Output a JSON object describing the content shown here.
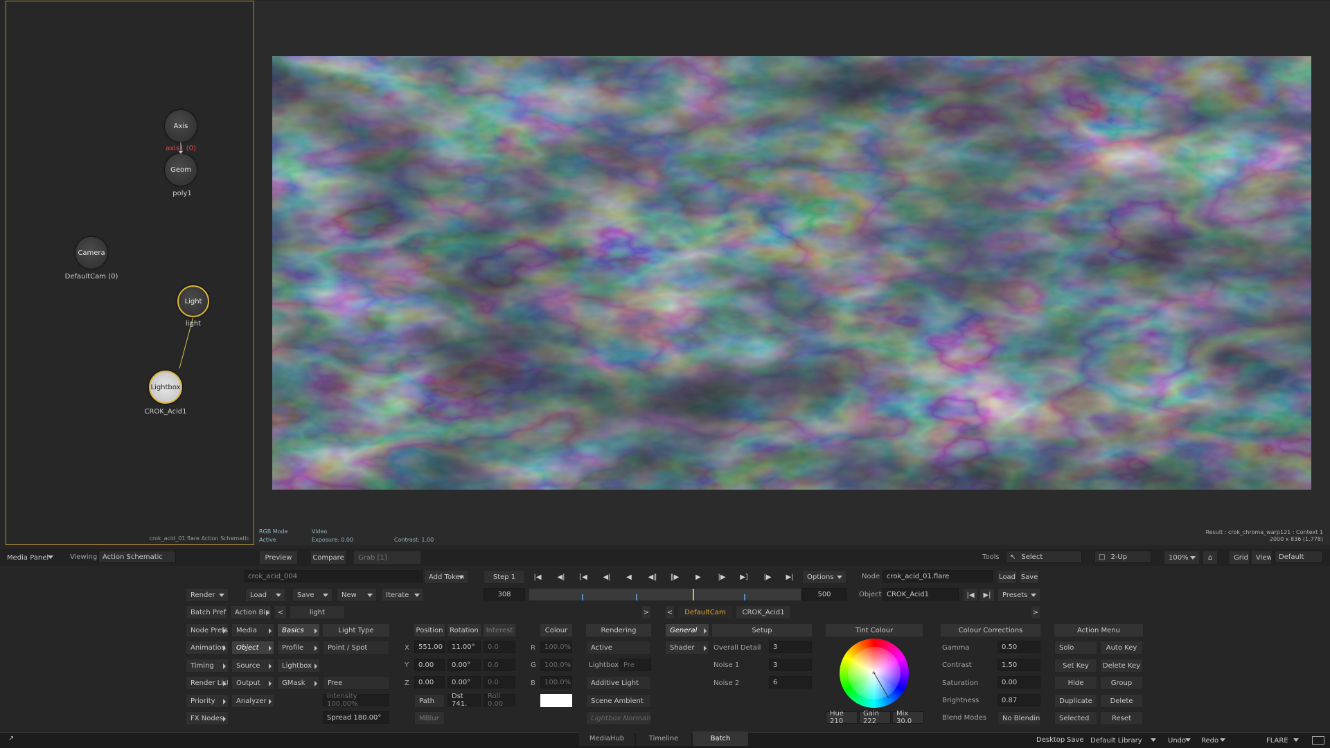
{
  "schematic": {
    "footer": "crok_acid_01.flare Action Schematic",
    "nodes": [
      {
        "title": "Axis",
        "label": "axis1 (0)",
        "type": "axis"
      },
      {
        "title": "Geom",
        "label": "poly1",
        "type": "geom"
      },
      {
        "title": "Camera",
        "label": "DefaultCam (0)",
        "type": "camera"
      },
      {
        "title": "Light",
        "label": "light",
        "type": "light"
      },
      {
        "title": "Lightbox",
        "label": "CROK_Acid1",
        "type": "lightbox"
      }
    ]
  },
  "viewer": {
    "info_left": [
      "RGB Mode",
      "Active"
    ],
    "info_mid": [
      "Video",
      "Exposure: 0.00"
    ],
    "contrast": "Contrast: 1.00",
    "result": "Result : crok_chroma_warp121 : Context 1",
    "resolution": "2000 x 836 (1.778)"
  },
  "topbar": {
    "media_panel": "Media Panel",
    "viewing_label": "Viewing",
    "viewing_value": "Action Schematic",
    "preview": "Preview",
    "compare": "Compare",
    "grab": "Grab [1]",
    "tools": "Tools",
    "select": "Select",
    "twoup": "2-Up",
    "zoom": "100%",
    "grid": "Grid",
    "view": "View",
    "default": "Default"
  },
  "row1": {
    "clip_name": "crok_acid_004",
    "add_token": "Add Token",
    "step": "Step 1",
    "frame": "308",
    "end_frame": "500",
    "options": "Options",
    "node_label": "Node",
    "node_value": "crok_acid_01.flare",
    "load": "Load",
    "save": "Save",
    "object_label": "Object",
    "object_value": "CROK_Acid1",
    "presets": "Presets"
  },
  "row2": {
    "render": "Render",
    "load": "Load",
    "save": "Save",
    "new": "New",
    "iterate": "Iterate"
  },
  "tabs": {
    "batch_prefs": "Batch Prefs",
    "action_bin": "Action Bin",
    "light_tab": "light",
    "cam_tab": "DefaultCam",
    "acid_tab": "CROK_Acid1"
  },
  "left_menu": [
    "Node Prefs",
    "Animation",
    "Timing",
    "Render List",
    "Priority",
    "FX Nodes"
  ],
  "col2": [
    "Media",
    "Object",
    "Source",
    "Output",
    "Analyzer"
  ],
  "col3": [
    "Basics",
    "Profile",
    "Lightbox",
    "GMask"
  ],
  "light_type": {
    "header": "Light Type",
    "value": "Point / Spot",
    "free": "Free",
    "intensity": "Intensity 100.00%",
    "spread": "Spread 180.00°"
  },
  "transform": {
    "position": "Position",
    "rotation": "Rotation",
    "interest": "Interest",
    "x_pos": "551.00",
    "x_rot": "11.00°",
    "x_int": "0.0",
    "y_pos": "0.00",
    "y_rot": "0.00°",
    "y_int": "0.0",
    "z_pos": "0.00",
    "z_rot": "0.00°",
    "z_int": "0.0",
    "path": "Path",
    "dist": "Dst 741.",
    "roll": "Roll 0.00",
    "mblur": "MBlur",
    "axes": [
      "X",
      "Y",
      "Z"
    ]
  },
  "colour": {
    "header": "Colour",
    "r": "100.0%",
    "g": "100.0%",
    "b": "100.0%",
    "labels": [
      "R",
      "G",
      "B"
    ],
    "swatch": "#ffffff"
  },
  "rendering": {
    "header": "Rendering",
    "active": "Active",
    "lightbox": "Lightbox",
    "pre": "Pre",
    "additive": "Additive Light",
    "scene_ambient": "Scene Ambient",
    "lightbox_normals": "Lightbox Normals"
  },
  "shader": {
    "general": "General",
    "shader": "Shader",
    "setup": "Setup",
    "overall_detail": "Overall Detail",
    "overall_value": "3",
    "noise1": "Noise 1",
    "noise1_value": "3",
    "noise2": "Noise 2",
    "noise2_value": "6"
  },
  "tint": {
    "header": "Tint Colour",
    "hue": "Hue 210",
    "gain": "Gain 222",
    "mix": "Mix 30.0"
  },
  "cc": {
    "header": "Colour Corrections",
    "gamma": "Gamma",
    "gamma_value": "0.50",
    "contrast": "Contrast",
    "contrast_value": "1.50",
    "saturation": "Saturation",
    "saturation_value": "0.00",
    "brightness": "Brightness",
    "brightness_value": "0.87",
    "blend": "Blend Modes",
    "blend_value": "No Blending"
  },
  "action_menu": {
    "header": "Action Menu",
    "solo": "Solo",
    "auto_key": "Auto Key",
    "set_key": "Set Key",
    "delete_key": "Delete Key",
    "hide": "Hide",
    "group": "Group",
    "duplicate": "Duplicate",
    "delete": "Delete",
    "selected": "Selected",
    "reset": "Reset"
  },
  "bottom": {
    "tabs": [
      "MediaHub",
      "Timeline",
      "Batch"
    ],
    "desktop": "Desktop",
    "save": "Save",
    "library": "Default Library",
    "undo": "Undo",
    "redo": "Redo",
    "app": "FLARE"
  }
}
